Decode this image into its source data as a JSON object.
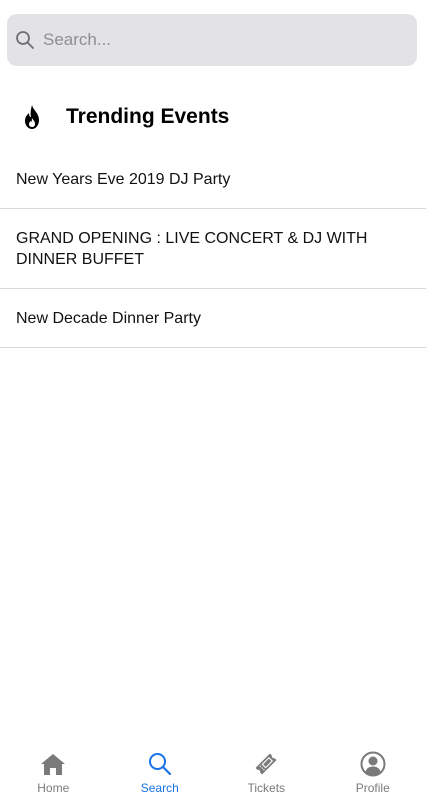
{
  "search": {
    "placeholder": "Search...",
    "value": ""
  },
  "section": {
    "icon": "fire-icon",
    "title": "Trending Events"
  },
  "events": [
    {
      "title": "New Years Eve 2019 DJ Party"
    },
    {
      "title": "GRAND OPENING :  LIVE CONCERT & DJ  WITH DINNER BUFFET"
    },
    {
      "title": "New Decade Dinner Party"
    }
  ],
  "tabs": [
    {
      "label": "Home",
      "icon": "home-icon",
      "active": false
    },
    {
      "label": "Search",
      "icon": "search-icon",
      "active": true
    },
    {
      "label": "Tickets",
      "icon": "ticket-icon",
      "active": false
    },
    {
      "label": "Profile",
      "icon": "profile-icon",
      "active": false
    }
  ],
  "colors": {
    "accent": "#1a73e8",
    "inactive": "#7a7a7a",
    "search_bg": "#e2e2e7"
  }
}
